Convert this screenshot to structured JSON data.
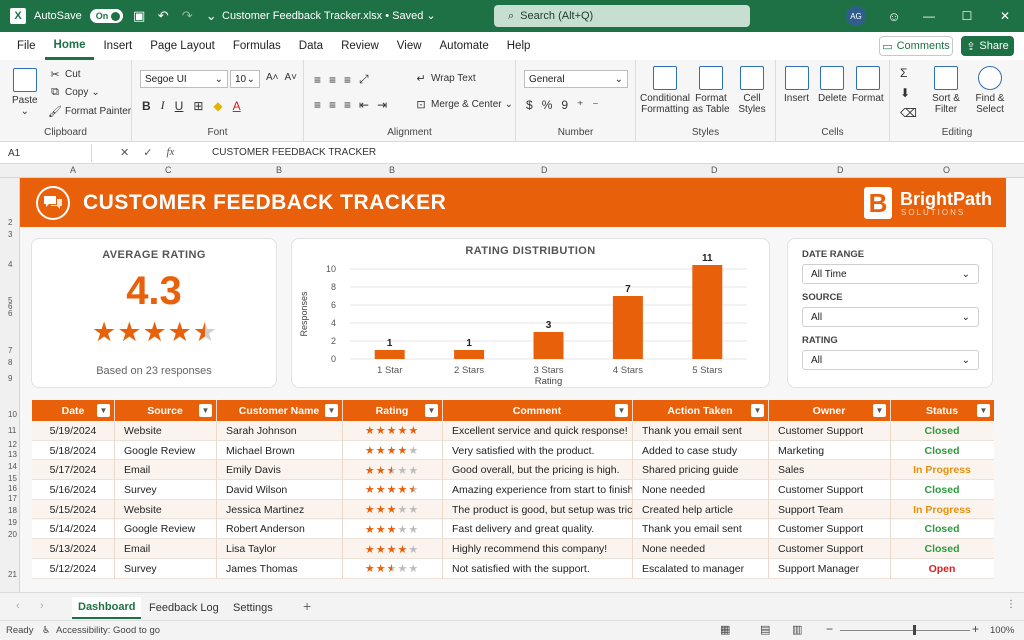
{
  "titlebar": {
    "autosave_label": "AutoSave",
    "autosave_state": "On",
    "doc_title": "Customer Feedback Tracker.xlsx",
    "saved_state": "Saved",
    "search_placeholder": "Search (Alt+Q)",
    "user_initials": "AG"
  },
  "menu": [
    "File",
    "Home",
    "Insert",
    "Page Layout",
    "Formulas",
    "Data",
    "Review",
    "View",
    "Automate",
    "Help"
  ],
  "menu_active": "Home",
  "actions": {
    "comments": "Comments",
    "share": "Share"
  },
  "ribbon": {
    "clipboard": {
      "paste": "Paste",
      "cut": "Cut",
      "copy": "Copy",
      "format_painter": "Format Painter",
      "label": "Clipboard"
    },
    "font": {
      "family": "Segoe UI",
      "size": "10",
      "label": "Font"
    },
    "alignment": {
      "wrap": "Wrap Text",
      "merge": "Merge & Center",
      "label": "Alignment"
    },
    "number": {
      "format": "General",
      "label": "Number"
    },
    "styles": {
      "conditional": "Conditional Formatting",
      "format_table": "Format as Table",
      "cell_styles": "Cell Styles",
      "label": "Styles"
    },
    "cells": {
      "insert": "Insert",
      "delete": "Delete",
      "format": "Format",
      "label": "Cells"
    },
    "editing": {
      "sort": "Sort & Filter",
      "find": "Find & Select",
      "label": "Editing"
    }
  },
  "formula_bar": {
    "cell_ref": "A1",
    "value": "CUSTOMER FEEDBACK TRACKER"
  },
  "column_headers": [
    "A",
    "C",
    "B",
    "B",
    "D",
    "D",
    "D",
    "O"
  ],
  "row_numbers": [
    "2",
    "3",
    "4",
    "5",
    "6",
    "6",
    "7",
    "8",
    "9",
    "10",
    "11",
    "12",
    "13",
    "14",
    "15",
    "16",
    "17",
    "18",
    "19",
    "20",
    "21"
  ],
  "banner": {
    "title": "CUSTOMER FEEDBACK TRACKER",
    "brand": "BrightPath",
    "brand_sub": "SOLUTIONS",
    "brand_letter": "B"
  },
  "avg_card": {
    "title": "AVERAGE RATING",
    "value": "4.3",
    "rating": 4.3,
    "note": "Based on 23 responses"
  },
  "chart_data": {
    "type": "bar",
    "title": "RATING DISTRIBUTION",
    "categories": [
      "1 Star",
      "2 Stars",
      "3 Stars",
      "4 Stars",
      "5 Stars"
    ],
    "values": [
      1,
      1,
      3,
      7,
      11
    ],
    "xlabel": "Rating",
    "ylabel": "Responses",
    "ylim": [
      0,
      10
    ],
    "yticks": [
      0,
      2,
      4,
      6,
      8,
      10
    ],
    "color": "#e8600a",
    "grid": true
  },
  "filters": [
    {
      "label": "DATE RANGE",
      "value": "All Time"
    },
    {
      "label": "SOURCE",
      "value": "All"
    },
    {
      "label": "RATING",
      "value": "All"
    }
  ],
  "table": {
    "columns": [
      "Date",
      "Source",
      "Customer Name",
      "Rating",
      "Comment",
      "Action Taken",
      "Owner",
      "Status"
    ],
    "rows": [
      {
        "date": "5/19/2024",
        "source": "Website",
        "name": "Sarah Johnson",
        "rating": 5,
        "comment": "Excellent service and quick response!",
        "action": "Thank you email sent",
        "owner": "Customer Support",
        "status": "Closed"
      },
      {
        "date": "5/18/2024",
        "source": "Google Review",
        "name": "Michael Brown",
        "rating": 4,
        "comment": "Very satisfied with the product.",
        "action": "Added to case study",
        "owner": "Marketing",
        "status": "Closed"
      },
      {
        "date": "5/17/2024",
        "source": "Email",
        "name": "Emily Davis",
        "rating": 2.5,
        "comment": "Good overall, but the pricing is high.",
        "action": "Shared pricing guide",
        "owner": "Sales",
        "status": "In Progress"
      },
      {
        "date": "5/16/2024",
        "source": "Survey",
        "name": "David Wilson",
        "rating": 4.5,
        "comment": "Amazing experience from start to finish.",
        "action": "None needed",
        "owner": "Customer Support",
        "status": "Closed"
      },
      {
        "date": "5/15/2024",
        "source": "Website",
        "name": "Jessica Martinez",
        "rating": 3,
        "comment": "The product is good, but setup was tricky.",
        "action": "Created help article",
        "owner": "Support Team",
        "status": "In Progress"
      },
      {
        "date": "5/14/2024",
        "source": "Google Review",
        "name": "Robert Anderson",
        "rating": 3,
        "comment": "Fast delivery and great quality.",
        "action": "Thank you email sent",
        "owner": "Customer Support",
        "status": "Closed"
      },
      {
        "date": "5/13/2024",
        "source": "Email",
        "name": "Lisa Taylor",
        "rating": 4,
        "comment": "Highly recommend this company!",
        "action": "None needed",
        "owner": "Customer Support",
        "status": "Closed"
      },
      {
        "date": "5/12/2024",
        "source": "Survey",
        "name": "James Thomas",
        "rating": 2.5,
        "comment": "Not satisfied with the support.",
        "action": "Escalated to manager",
        "owner": "Support Manager",
        "status": "Open"
      }
    ]
  },
  "status_colors": {
    "Closed": "#2e9a3e",
    "In Progress": "#e8900a",
    "Open": "#d81e1e"
  },
  "sheet_tabs": [
    "Dashboard",
    "Feedback Log",
    "Settings"
  ],
  "sheet_active": "Dashboard",
  "statusbar": {
    "ready": "Ready",
    "accessibility": "Accessibility: Good to go",
    "zoom": "100%"
  }
}
